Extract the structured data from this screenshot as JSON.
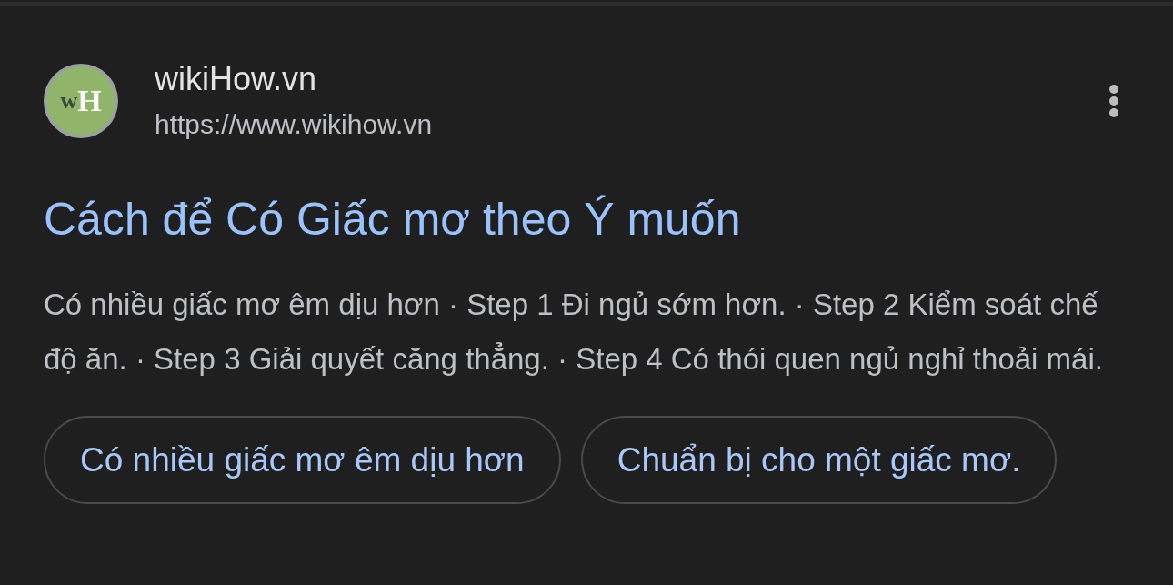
{
  "result": {
    "logo": {
      "letters": [
        "w",
        "H"
      ]
    },
    "site_name": "wikiHow.vn",
    "url": "https://www.wikihow.vn",
    "title": "Cách để Có Giấc mơ theo Ý muốn",
    "snippet": "Có nhiều giấc mơ êm dịu hơn · Step 1 Đi ngủ sớm hơn. · Step 2 Kiểm soát chế độ ăn. · Step 3 Giải quyết căng thẳng. · Step 4 Có thói quen ngủ nghỉ thoải mái.",
    "chips": [
      "Có nhiều giấc mơ êm dịu hơn",
      "Chuẩn bị cho một giấc mơ."
    ]
  }
}
